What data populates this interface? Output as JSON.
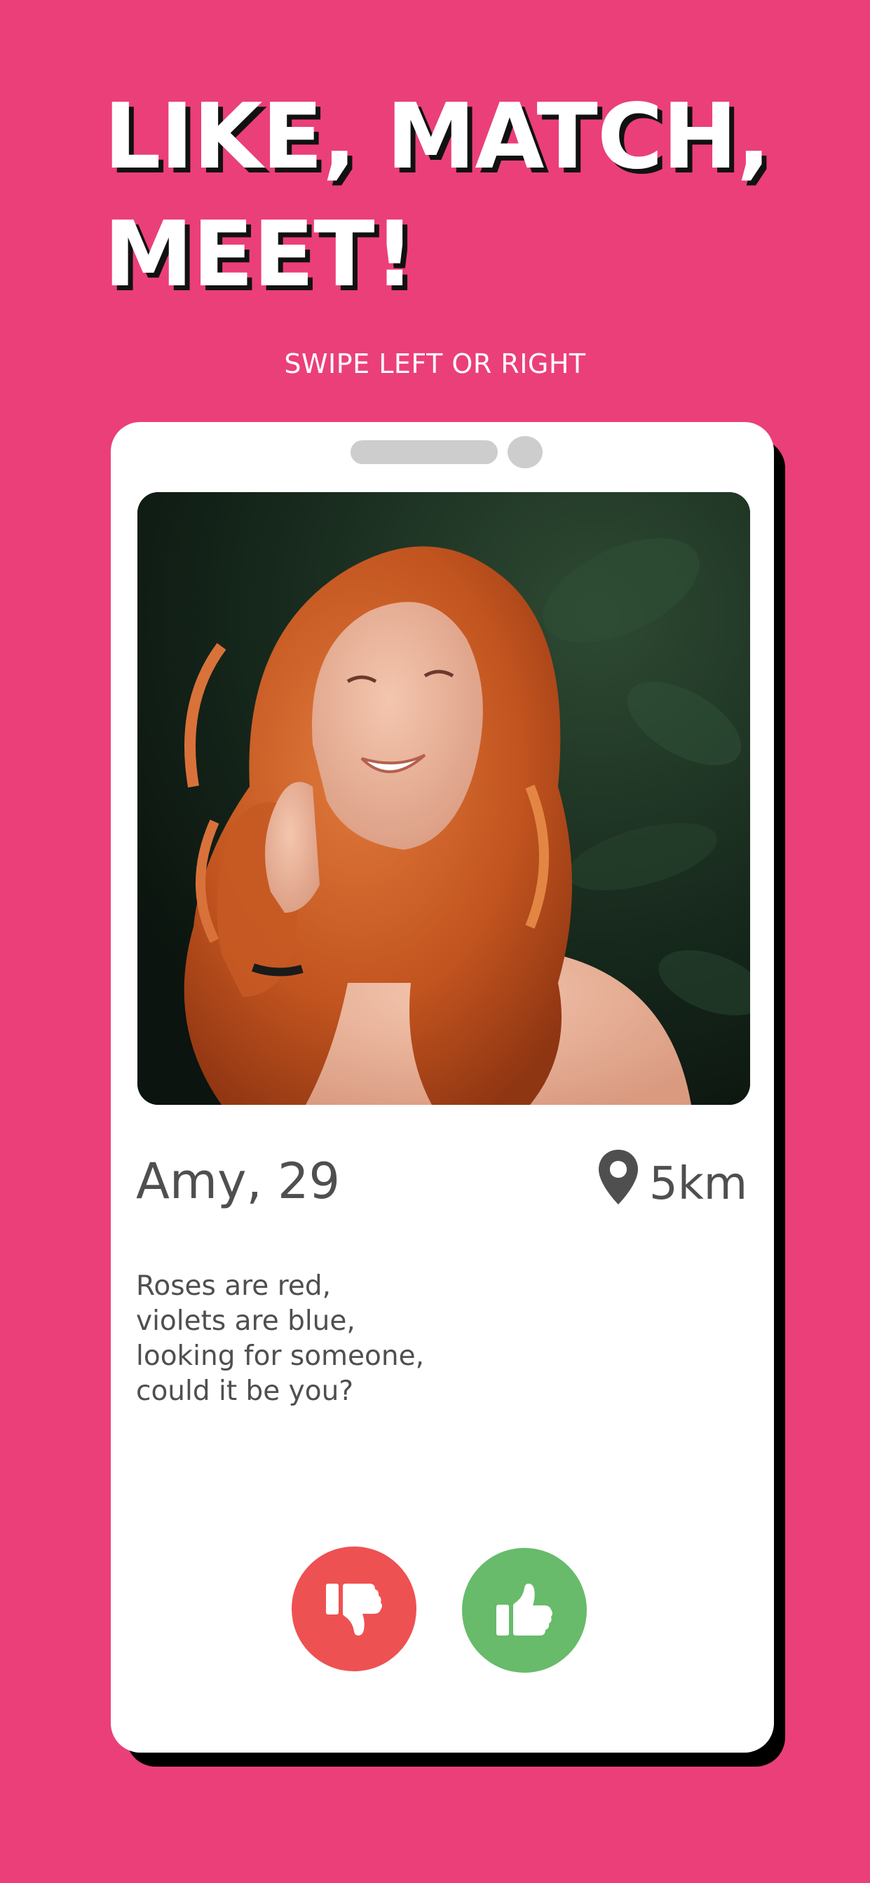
{
  "headline": {
    "line1": "LIKE, MATCH,",
    "line2": "MEET!"
  },
  "subtitle": "SWIPE LEFT OR RIGHT",
  "profile": {
    "name_age": "Amy, 29",
    "distance": "5km",
    "bio_lines": [
      "Roses are red,",
      "violets are blue,",
      "looking for someone,",
      "could it be you?"
    ]
  },
  "actions": {
    "dislike_icon": "thumbs-down-icon",
    "like_icon": "thumbs-up-icon"
  },
  "colors": {
    "background": "#EB3F79",
    "dislike": "#EE5152",
    "like": "#67BB6A",
    "text": "#4F4F4F"
  }
}
